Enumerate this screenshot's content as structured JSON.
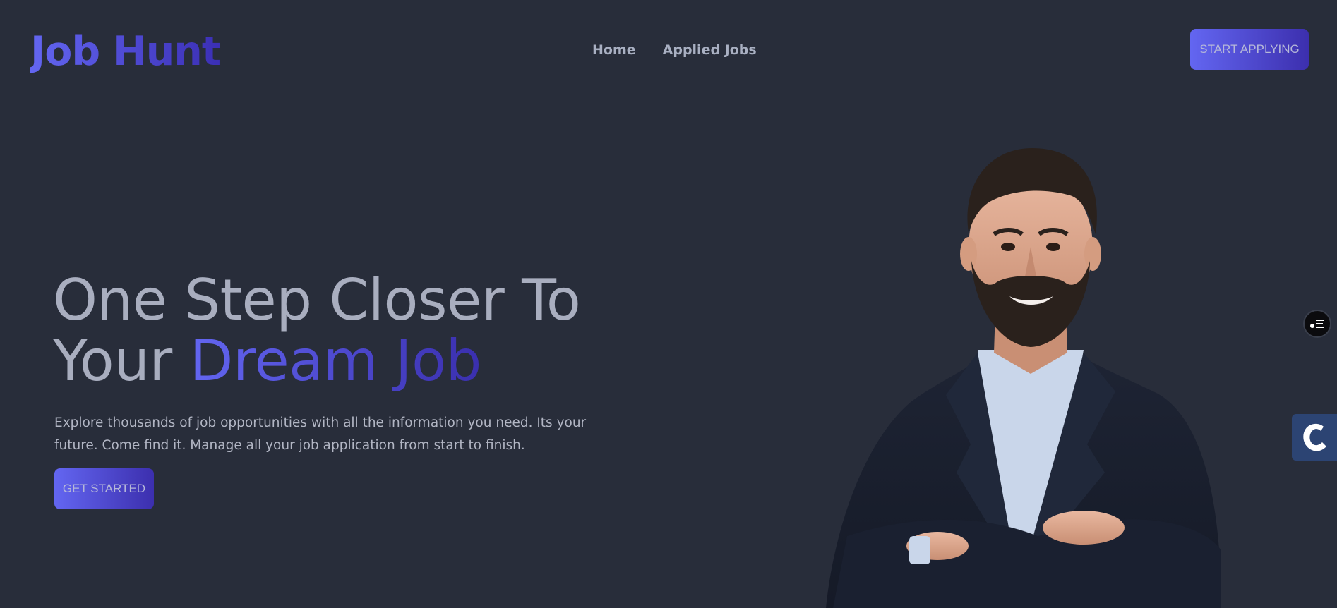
{
  "header": {
    "logo_text": "Job Hunt",
    "nav": [
      {
        "label": "Home"
      },
      {
        "label": "Applied Jobs"
      }
    ],
    "cta_label": "START APPLYING"
  },
  "hero": {
    "headline_line1": "One Step Closer To",
    "headline_line2_plain": "Your ",
    "headline_line2_accent": "Dream Job",
    "description": "Explore thousands of job opportunities with all the information you need. Its your future. Come find it. Manage all your job application from start to finish.",
    "cta_label": "GET STARTED",
    "image_alt": "Smiling man in a dark blazer with arms crossed"
  },
  "widgets": {
    "round_icon": "settings-list-icon",
    "side_icon": "c-logo-icon"
  },
  "colors": {
    "background": "#282d3a",
    "accent_start": "#6366f1",
    "accent_end": "#3b2fb5",
    "text_muted": "#a9aebf"
  }
}
